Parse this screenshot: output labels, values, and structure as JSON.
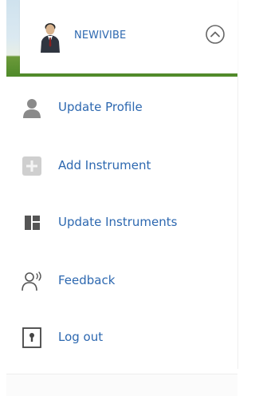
{
  "header": {
    "username": "NEWIVIBE",
    "avatar_icon": "user-avatar-icon",
    "collapse_icon": "chevron-up-circle-icon"
  },
  "menu": {
    "items": [
      {
        "label": "Update Profile",
        "icon": "person-icon"
      },
      {
        "label": "Add Instrument",
        "icon": "add-box-icon"
      },
      {
        "label": "Update Instruments",
        "icon": "dashboard-icon"
      },
      {
        "label": "Feedback",
        "icon": "feedback-voice-icon"
      },
      {
        "label": "Log out",
        "icon": "logout-door-icon"
      }
    ]
  },
  "colors": {
    "accent_text": "#2d68b0",
    "icon_gray": "#8a8a8a"
  }
}
